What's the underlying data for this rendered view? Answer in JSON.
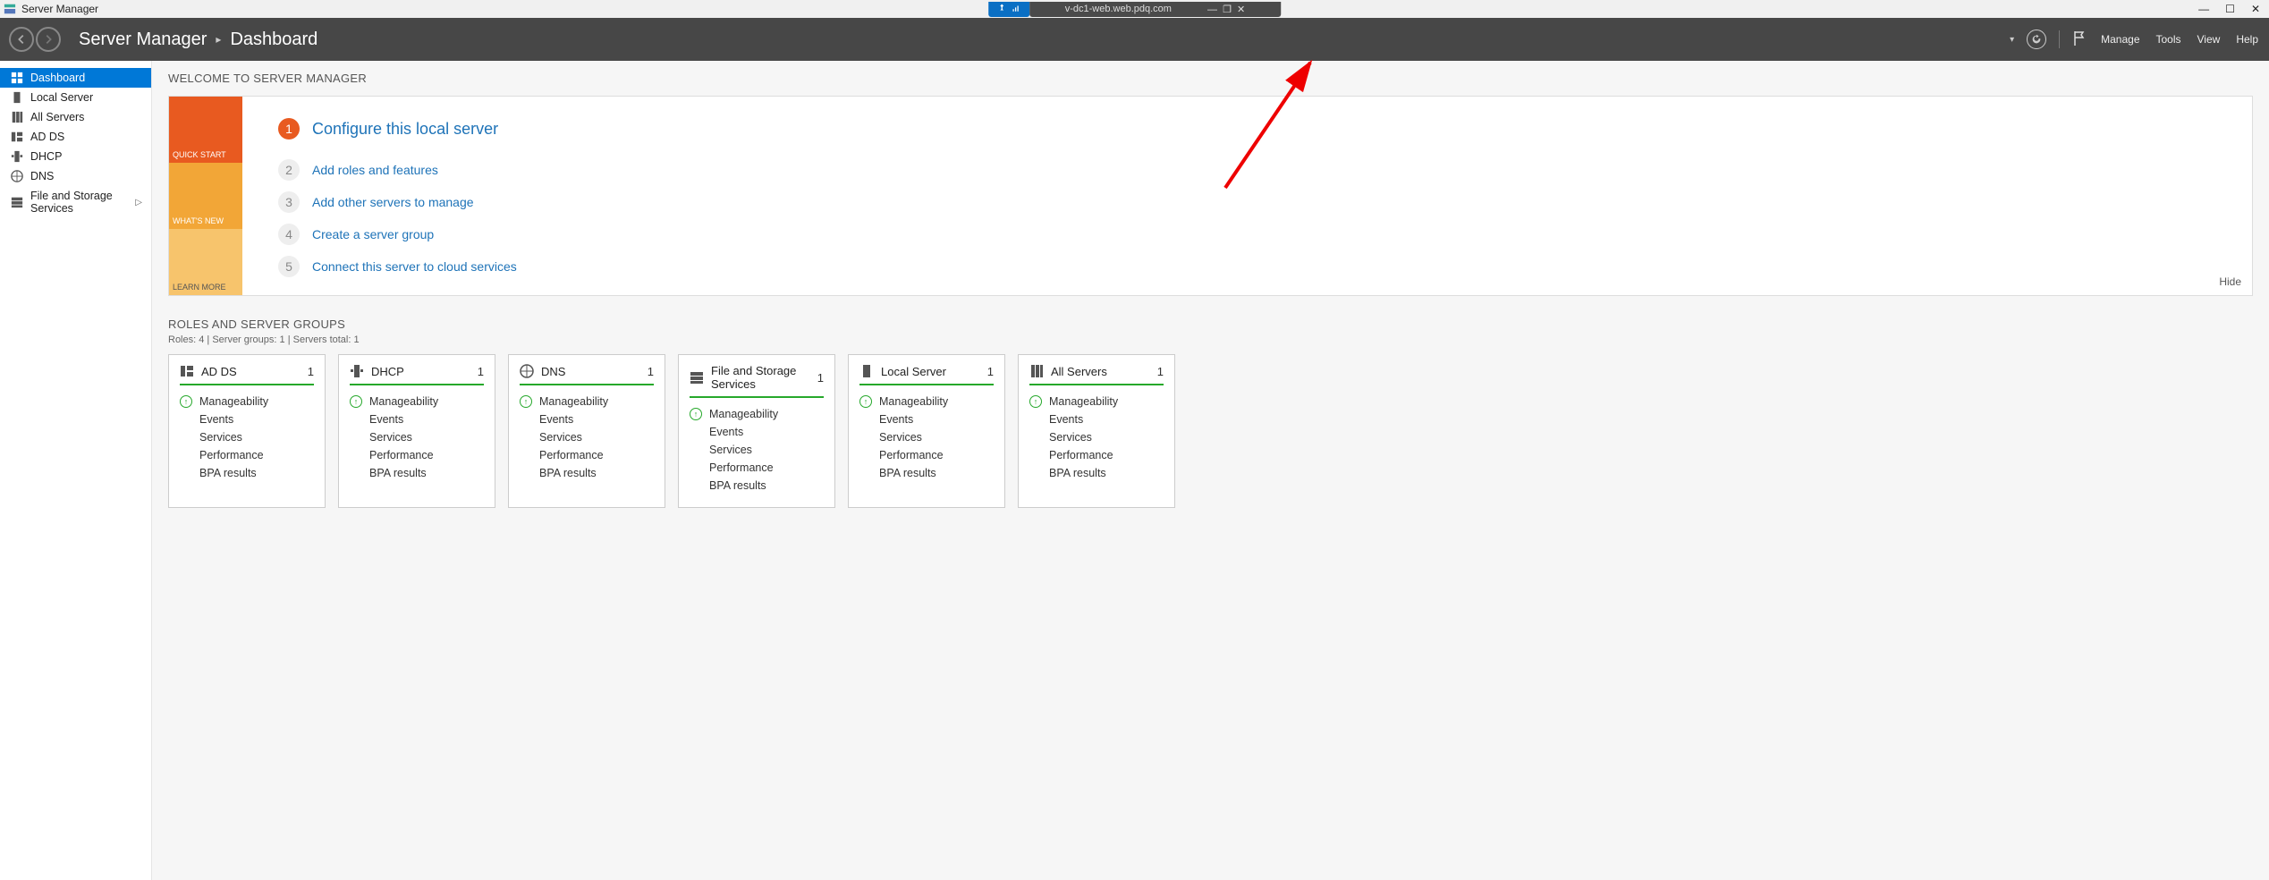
{
  "window": {
    "title": "Server Manager",
    "remote_host": "v-dc1-web.web.pdq.com"
  },
  "header": {
    "breadcrumb_root": "Server Manager",
    "breadcrumb_page": "Dashboard",
    "menu": {
      "manage": "Manage",
      "tools": "Tools",
      "view": "View",
      "help": "Help"
    }
  },
  "sidebar": {
    "items": [
      {
        "label": "Dashboard",
        "active": true
      },
      {
        "label": "Local Server"
      },
      {
        "label": "All Servers"
      },
      {
        "label": "AD DS"
      },
      {
        "label": "DHCP"
      },
      {
        "label": "DNS"
      },
      {
        "label": "File and Storage Services",
        "has_sub": true
      }
    ]
  },
  "welcome": {
    "title": "WELCOME TO SERVER MANAGER",
    "tabs": {
      "qs": "QUICK START",
      "wn": "WHAT'S NEW",
      "lm": "LEARN MORE"
    },
    "steps": [
      {
        "n": "1",
        "label": "Configure this local server"
      },
      {
        "n": "2",
        "label": "Add roles and features"
      },
      {
        "n": "3",
        "label": "Add other servers to manage"
      },
      {
        "n": "4",
        "label": "Create a server group"
      },
      {
        "n": "5",
        "label": "Connect this server to cloud services"
      }
    ],
    "hide": "Hide"
  },
  "roles": {
    "title": "ROLES AND SERVER GROUPS",
    "sub": "Roles: 4   |   Server groups: 1   |   Servers total: 1",
    "tile_rows": {
      "manage": "Manageability",
      "events": "Events",
      "services": "Services",
      "performance": "Performance",
      "bpa": "BPA results"
    },
    "tiles": [
      {
        "name": "AD DS",
        "count": "1"
      },
      {
        "name": "DHCP",
        "count": "1"
      },
      {
        "name": "DNS",
        "count": "1"
      },
      {
        "name": "File and Storage Services",
        "count": "1"
      },
      {
        "name": "Local Server",
        "count": "1"
      },
      {
        "name": "All Servers",
        "count": "1"
      }
    ]
  }
}
